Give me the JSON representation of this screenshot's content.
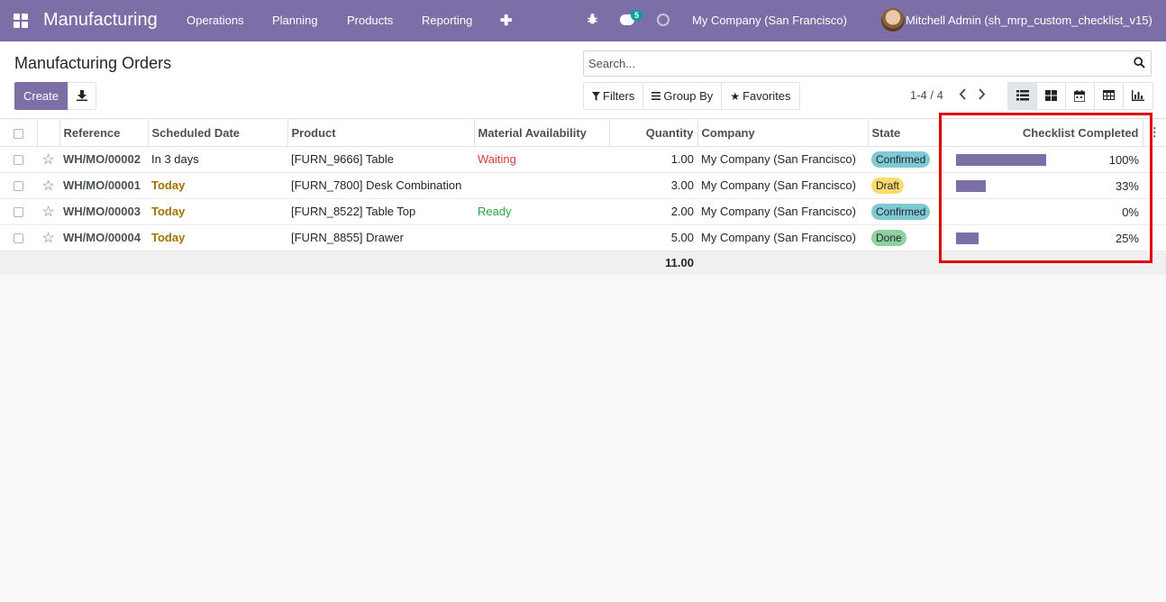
{
  "navbar": {
    "app_title": "Manufacturing",
    "menu": [
      "Operations",
      "Planning",
      "Products",
      "Reporting"
    ],
    "messages_count": "5",
    "company": "My Company (San Francisco)",
    "user": "Mitchell Admin (sh_mrp_custom_checklist_v15)"
  },
  "control_panel": {
    "title": "Manufacturing Orders",
    "create_label": "Create",
    "search_placeholder": "Search...",
    "filters_label": "Filters",
    "groupby_label": "Group By",
    "favorites_label": "Favorites",
    "pager": "1-4 / 4"
  },
  "columns": [
    "Reference",
    "Scheduled Date",
    "Product",
    "Material Availability",
    "Quantity",
    "Company",
    "State",
    "Checklist Completed"
  ],
  "rows": [
    {
      "reference": "WH/MO/00002",
      "date": "In 3 days",
      "product": "[FURN_9666] Table",
      "availability": "Waiting",
      "quantity": "1.00",
      "company": "My Company (San Francisco)",
      "state": "Confirmed",
      "checklist": 100,
      "checklist_label": "100%"
    },
    {
      "reference": "WH/MO/00001",
      "date": "Today",
      "product": "[FURN_7800] Desk Combination",
      "availability": "",
      "quantity": "3.00",
      "company": "My Company (San Francisco)",
      "state": "Draft",
      "checklist": 33,
      "checklist_label": "33%"
    },
    {
      "reference": "WH/MO/00003",
      "date": "Today",
      "product": "[FURN_8522] Table Top",
      "availability": "Ready",
      "quantity": "2.00",
      "company": "My Company (San Francisco)",
      "state": "Confirmed",
      "checklist": 0,
      "checklist_label": "0%"
    },
    {
      "reference": "WH/MO/00004",
      "date": "Today",
      "product": "[FURN_8855] Drawer",
      "availability": "",
      "quantity": "5.00",
      "company": "My Company (San Francisco)",
      "state": "Done",
      "checklist": 25,
      "checklist_label": "25%"
    }
  ],
  "totals": {
    "quantity": "11.00"
  },
  "colors": {
    "brand": "#7c6fa8",
    "confirmed": "#7ec9d3",
    "draft": "#fddc6d",
    "done": "#8fd19e",
    "highlight": "#e00000"
  }
}
